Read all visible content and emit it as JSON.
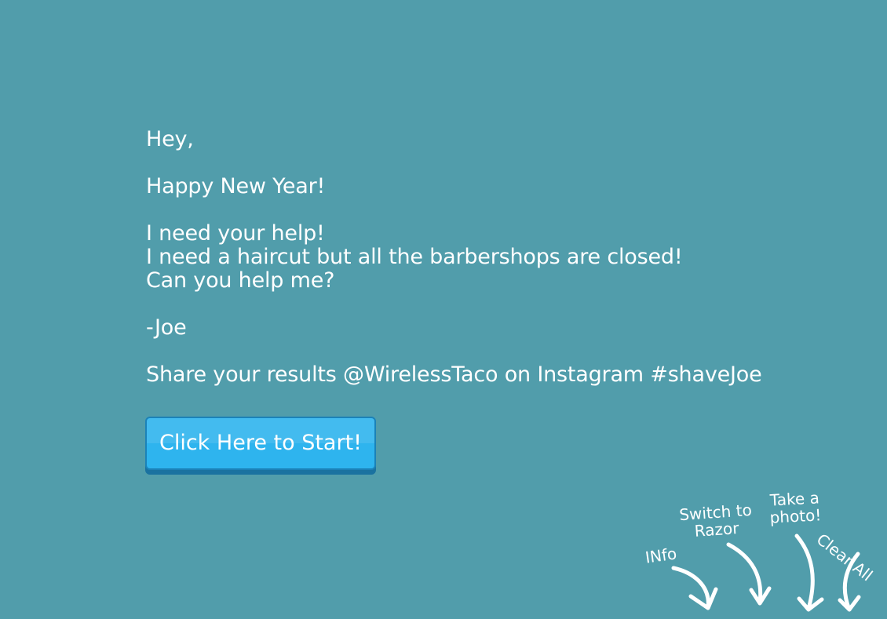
{
  "letter": {
    "greeting": "Hey,",
    "wish": "Happy New Year!",
    "line1": "I need your help!",
    "line2": "I need a haircut but all the barbershops are closed!",
    "line3": "Can you help me?",
    "signature": "-Joe",
    "share": "Share your results @WirelessTaco on Instagram #shaveJoe"
  },
  "start_button": {
    "label": "Click Here to Start!"
  },
  "hints": {
    "info": "INfo",
    "switch_line1": "Switch to",
    "switch_line2": "Razor",
    "photo_line1": "Take a",
    "photo_line2": "photo!",
    "clear": "Clear All"
  },
  "colors": {
    "background": "#519dab",
    "button": "#2eb4ee",
    "button_border": "#1b82b8",
    "text": "#ffffff"
  },
  "icons": [
    "info-arrow-icon",
    "razor-arrow-icon",
    "photo-arrow-icon",
    "clear-arrow-icon"
  ]
}
